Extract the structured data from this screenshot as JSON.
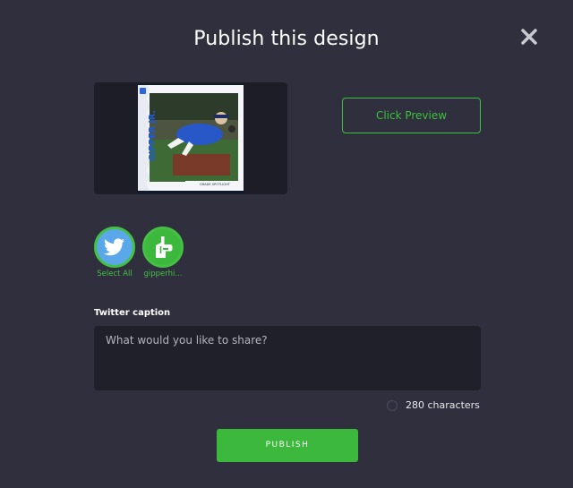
{
  "modal": {
    "title": "Publish this design"
  },
  "preview": {
    "card_name": "GIPPER JR.",
    "card_caption": "GRADE SPOTLIGHT",
    "button_label": "Click Preview"
  },
  "accounts": [
    {
      "icon": "twitter-bird-icon",
      "label": "Select All"
    },
    {
      "icon": "foam-finger-icon",
      "label": "gipperhi..."
    }
  ],
  "caption": {
    "label": "Twitter caption",
    "placeholder": "What would you like to share?",
    "value": ""
  },
  "counter": {
    "text": "280 characters"
  },
  "actions": {
    "publish_label": "PUBLISH"
  },
  "colors": {
    "background": "#2f2f3d",
    "accent_green": "#3cb93c",
    "twitter_blue": "#5aa8ea"
  }
}
